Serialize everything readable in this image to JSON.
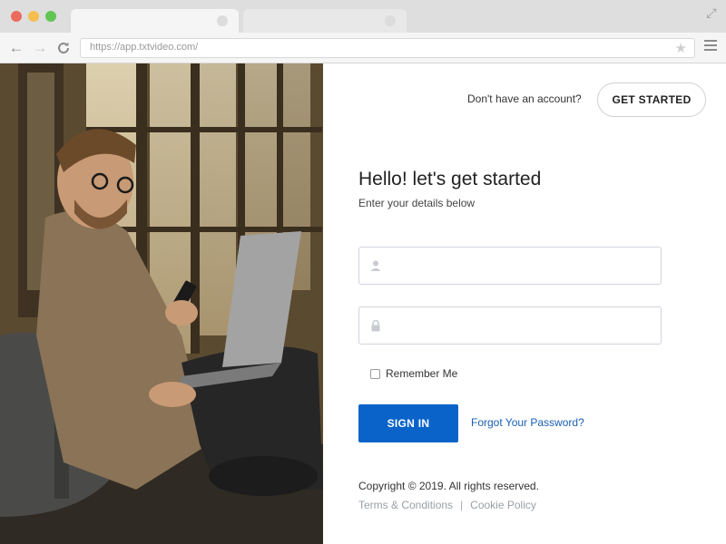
{
  "browser": {
    "url": "https://app.txtvideo.com/",
    "colors": {
      "close": "#ed6a5e",
      "minimize": "#f4bf4f",
      "maximize": "#61c554"
    }
  },
  "header": {
    "prompt": "Don't have an account?",
    "cta_label": "GET STARTED"
  },
  "form": {
    "title": "Hello! let's get started",
    "subtitle": "Enter your details below",
    "username": {
      "value": "",
      "icon": "user-icon"
    },
    "password": {
      "value": "",
      "icon": "lock-icon"
    },
    "remember_label": "Remember Me",
    "remember_checked": false,
    "signin_label": "SIGN IN",
    "forgot_label": "Forgot Your Password?"
  },
  "footer": {
    "copyright": "Copyright © 2019. All rights reserved.",
    "links": [
      "Terms & Conditions",
      "Cookie Policy"
    ],
    "separator": "|"
  },
  "theme": {
    "primary": "#0a63c9",
    "link": "#1a5fb4"
  }
}
